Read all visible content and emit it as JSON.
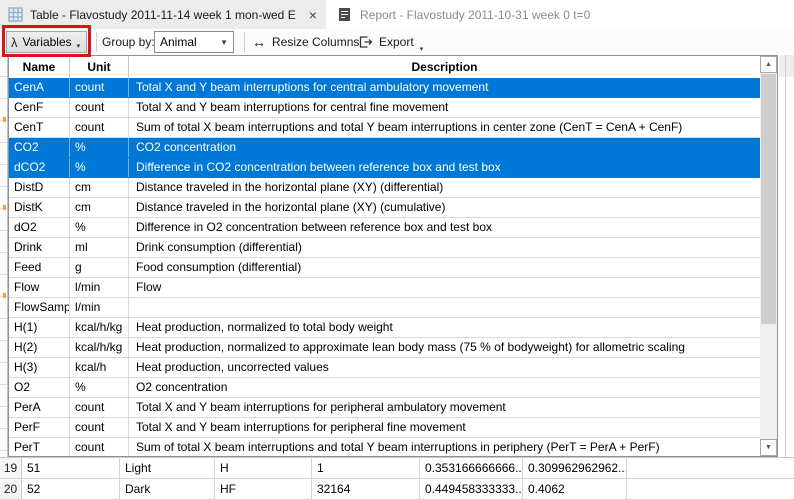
{
  "tabs": [
    {
      "label": "Table - Flavostudy 2011-11-14 week 1 mon-wed E",
      "icon": "table-grid-icon",
      "close_glyph": "×",
      "active": true
    },
    {
      "label": "Report - Flavostudy 2011-10-31 week 0 t=0",
      "icon": "report-icon",
      "active": false
    }
  ],
  "toolbar": {
    "variables_label": "Variables",
    "lambda_glyph": "λ",
    "dropdown_glyph": "▾",
    "group_by_label": "Group by:",
    "group_by_value": "Animal",
    "combo_arrow_glyph": "▼",
    "resize_glyph": "↔",
    "resize_label": "Resize Columns",
    "export_label": "Export"
  },
  "variables_table": {
    "columns": [
      "Name",
      "Unit",
      "Description"
    ],
    "rows": [
      {
        "name": "CenA",
        "unit": "count",
        "description": "Total X and Y beam interruptions for central ambulatory movement",
        "selected": true
      },
      {
        "name": "CenF",
        "unit": "count",
        "description": "Total X and Y beam interruptions for central fine movement",
        "selected": false
      },
      {
        "name": "CenT",
        "unit": "count",
        "description": "Sum of total X beam interruptions and total Y beam interruptions in center zone (CenT = CenA + CenF)",
        "selected": false
      },
      {
        "name": "CO2",
        "unit": "%",
        "description": "CO2 concentration",
        "selected": true
      },
      {
        "name": "dCO2",
        "unit": "%",
        "description": "Difference in CO2 concentration between reference box and test box",
        "selected": true
      },
      {
        "name": "DistD",
        "unit": "cm",
        "description": "Distance traveled in the horizontal plane (XY) (differential)",
        "selected": false
      },
      {
        "name": "DistK",
        "unit": "cm",
        "description": "Distance traveled in the horizontal plane (XY) (cumulative)",
        "selected": false
      },
      {
        "name": "dO2",
        "unit": "%",
        "description": "Difference in O2 concentration between reference box and test box",
        "selected": false
      },
      {
        "name": "Drink",
        "unit": "ml",
        "description": "Drink consumption (differential)",
        "selected": false
      },
      {
        "name": "Feed",
        "unit": "g",
        "description": "Food consumption (differential)",
        "selected": false
      },
      {
        "name": "Flow",
        "unit": "l/min",
        "description": "Flow",
        "selected": false
      },
      {
        "name": "FlowSamp",
        "unit": "l/min",
        "description": "",
        "selected": false
      },
      {
        "name": "H(1)",
        "unit": "kcal/h/kg",
        "description": "Heat production, normalized to total body weight",
        "selected": false
      },
      {
        "name": "H(2)",
        "unit": "kcal/h/kg",
        "description": "Heat production, normalized to approximate lean body mass (75 % of bodyweight) for allometric scaling",
        "selected": false
      },
      {
        "name": "H(3)",
        "unit": "kcal/h",
        "description": "Heat production, uncorrected values",
        "selected": false
      },
      {
        "name": "O2",
        "unit": "%",
        "description": "O2 concentration",
        "selected": false
      },
      {
        "name": "PerA",
        "unit": "count",
        "description": "Total X and Y beam interruptions for peripheral ambulatory movement",
        "selected": false
      },
      {
        "name": "PerF",
        "unit": "count",
        "description": "Total X and Y beam interruptions for peripheral fine movement",
        "selected": false
      },
      {
        "name": "PerT",
        "unit": "count",
        "description": "Sum of total X beam interruptions and total Y beam interruptions in periphery (PerT = PerA + PerF)",
        "selected": false
      }
    ],
    "scrollbar": {
      "up_glyph": "▲",
      "down_glyph": "▼"
    }
  },
  "background_table": {
    "rows": [
      {
        "num": "19",
        "cells": [
          "51",
          "Light",
          "H",
          "1",
          "0.353166666666...",
          "0.309962962962..."
        ]
      },
      {
        "num": "20",
        "cells": [
          "52",
          "Dark",
          "HF",
          "32164",
          "0.449458333333...",
          "0.4062"
        ]
      }
    ]
  },
  "colors": {
    "selection_blue": "#0078d7",
    "annotation_red": "#dd1414"
  }
}
